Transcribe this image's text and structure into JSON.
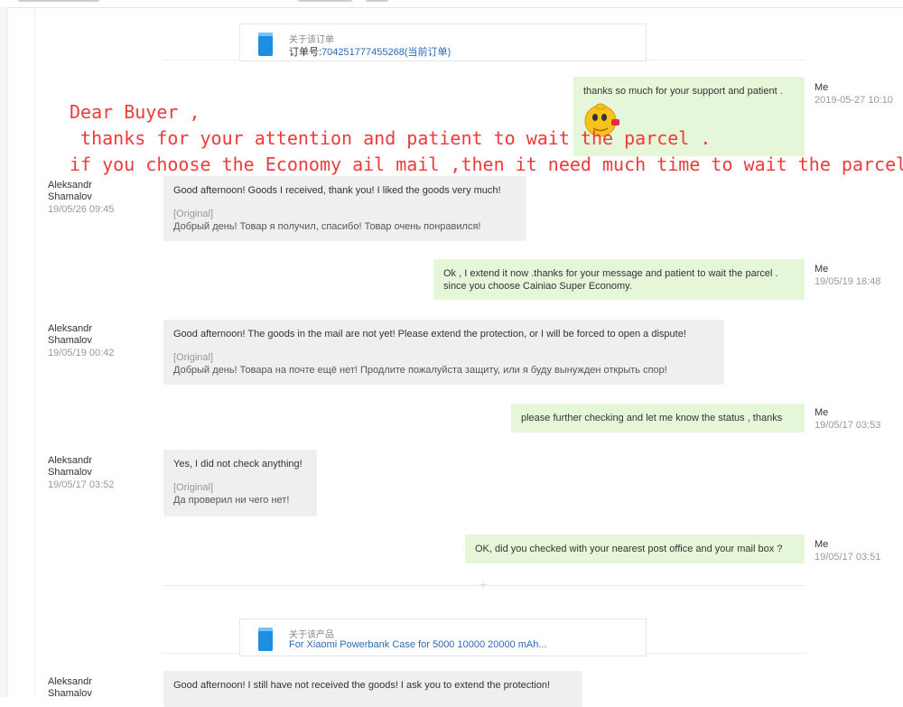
{
  "order_card": {
    "caption": "关于该订单",
    "label": "订单号:",
    "number": "704251777455268",
    "status": "(当前订单)"
  },
  "product_card": {
    "caption": "关于该产品",
    "title": "For Xiaomi Powerbank Case for 5000 10000 20000 mAh..."
  },
  "overlay": {
    "line1": "Dear Buyer ,",
    "line2": " thanks for your attention and patient to wait the parcel .",
    "line3": "if you choose the Economy ail mail ,then it need much time to wait the parcel."
  },
  "messages": [
    {
      "side": "me",
      "author": "Me",
      "time": "2019-05-27 10:10",
      "text": "thanks so much for your support and patient ."
    },
    {
      "side": "them",
      "author": "Aleksandr Shamalov",
      "time": "19/05/26 09:45",
      "text": "Good afternoon! Goods I received, thank you! I liked the goods very much!",
      "original_label": "[Original]",
      "original": "Добрый день! Товар я получил, спасибо! Товар очень понравился!"
    },
    {
      "side": "me",
      "author": "Me",
      "time": "19/05/19 18:48",
      "text": "Ok , I extend it now .thanks for your message and patient to wait the parcel .",
      "text2": "since you choose Cainiao Super Economy."
    },
    {
      "side": "them",
      "author": "Aleksandr Shamalov",
      "time": "19/05/19 00:42",
      "text": "Good afternoon! The goods in the mail are not yet! Please extend the protection, or I will be forced to open a dispute!",
      "original_label": "[Original]",
      "original": "Добрый день! Товара на почте ещё нет! Продлите пожалуйста защиту, или я буду вынужден открыть спор!"
    },
    {
      "side": "me",
      "author": "Me",
      "time": "19/05/17 03:53",
      "text": "please further checking and let me know the status , thanks"
    },
    {
      "side": "them",
      "author": "Aleksandr Shamalov",
      "time": "19/05/17 03:52",
      "text": "Yes, I did not check anything!",
      "original_label": "[Original]",
      "original": "Да проверил ни чего нет!"
    },
    {
      "side": "me",
      "author": "Me",
      "time": "19/05/17 03:51",
      "text": "OK, did you checked with your nearest post office and your mail box ?"
    },
    {
      "side": "them",
      "author": "Aleksandr Shamalov",
      "time": "",
      "text": "Good afternoon! I still have not received the goods! I ask you to extend the protection!"
    }
  ],
  "colors": {
    "me_bubble": "#e6f6d9",
    "them_bubble": "#efefef",
    "overlay_text": "#ee3a3a",
    "link": "#2a6ab8"
  },
  "icons": [
    "document-icon",
    "emoji-icon"
  ]
}
